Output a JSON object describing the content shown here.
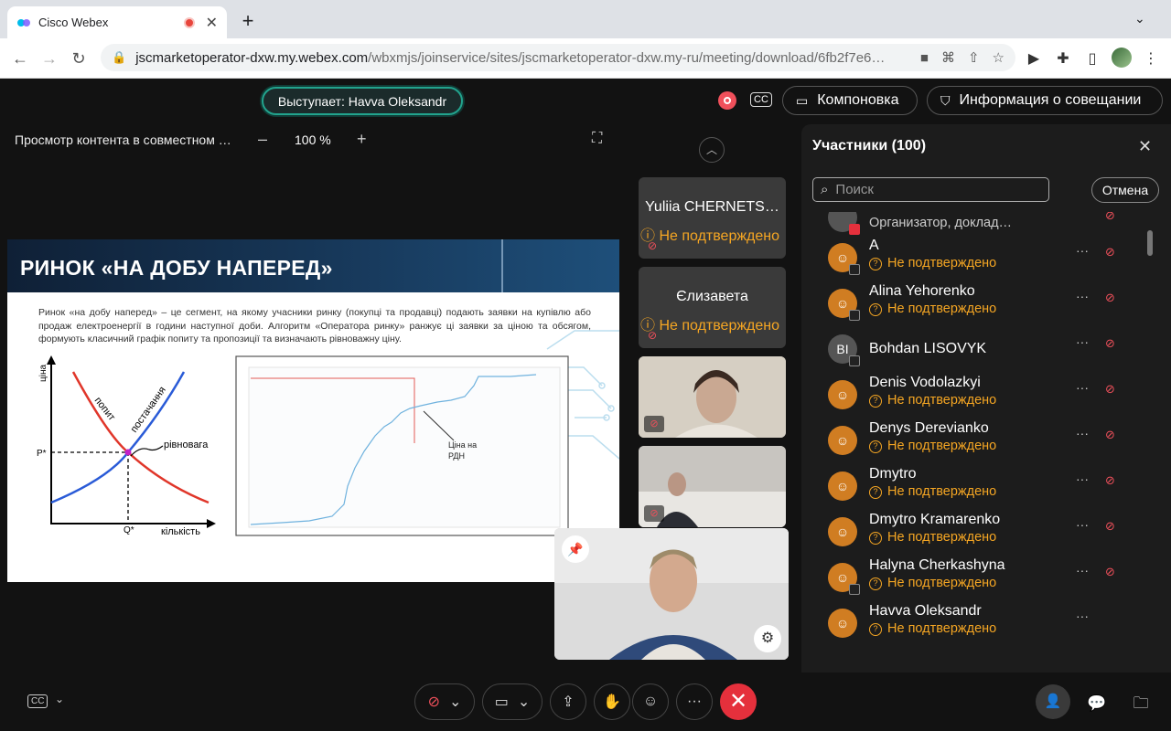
{
  "browser": {
    "tab_title": "Cisco Webex",
    "url_host": "jscmarketoperator-dxw.my.webex.com",
    "url_path": "/wbxmjs/joinservice/sites/jscmarketoperator-dxw.my-ru/meeting/download/6fb2f7e6…"
  },
  "meeting": {
    "speaker_label": "Выступает: Havva Oleksandr",
    "cc_label": "CC",
    "layout_label": "Компоновка",
    "info_label": "Информация о совещании"
  },
  "share": {
    "title": "Просмотр контента в совместном …",
    "zoom": "100 %",
    "minus": "–",
    "plus": "+"
  },
  "slide": {
    "title": "РИНОК «НА ДОБУ НАПЕРЕД»",
    "text": "Ринок «на добу наперед» – це сегмент, на якому учасники ринку (покупці та продавці) подають заявки на купівлю або продаж електроенергії в години наступної доби. Алгоритм «Оператора ринку» ранжує ці заявки за ціною та обсягом, формують класичний графік попиту та пропозиції та визначають рівноважну ціну.",
    "graph": {
      "y_label": "ціна",
      "x_label": "кількість",
      "demand": "попит",
      "supply": "постачання",
      "equilibrium": "рівновага",
      "p_star": "P*",
      "q_star": "Q*"
    },
    "chart_annotation_1": "Ціна на",
    "chart_annotation_2": "РДН"
  },
  "tiles": [
    {
      "name": "Yuliia CHERNETS…",
      "status": "Не подтверждено"
    },
    {
      "name": "Єлизавета",
      "status": "Не подтверждено"
    }
  ],
  "participants": {
    "title": "Участники (100)",
    "search_placeholder": "Поиск",
    "cancel": "Отмена",
    "first_role": "Организатор, доклад…",
    "list": [
      {
        "name": "A",
        "status": "Не подтверждено",
        "initials": ""
      },
      {
        "name": "Alina Yehorenko",
        "status": "Не подтверждено",
        "initials": ""
      },
      {
        "name": "Bohdan LISOVYK",
        "status": "",
        "initials": "BI"
      },
      {
        "name": "Denis Vodolazkyi",
        "status": "Не подтверждено",
        "initials": ""
      },
      {
        "name": "Denys Derevianko",
        "status": "Не подтверждено",
        "initials": ""
      },
      {
        "name": "Dmytro",
        "status": "Не подтверждено",
        "initials": ""
      },
      {
        "name": "Dmytro Kramarenko",
        "status": "Не подтверждено",
        "initials": ""
      },
      {
        "name": "Halyna Cherkashyna",
        "status": "Не подтверждено",
        "initials": ""
      },
      {
        "name": "Havva Oleksandr",
        "status": "Не подтверждено",
        "initials": ""
      }
    ]
  }
}
